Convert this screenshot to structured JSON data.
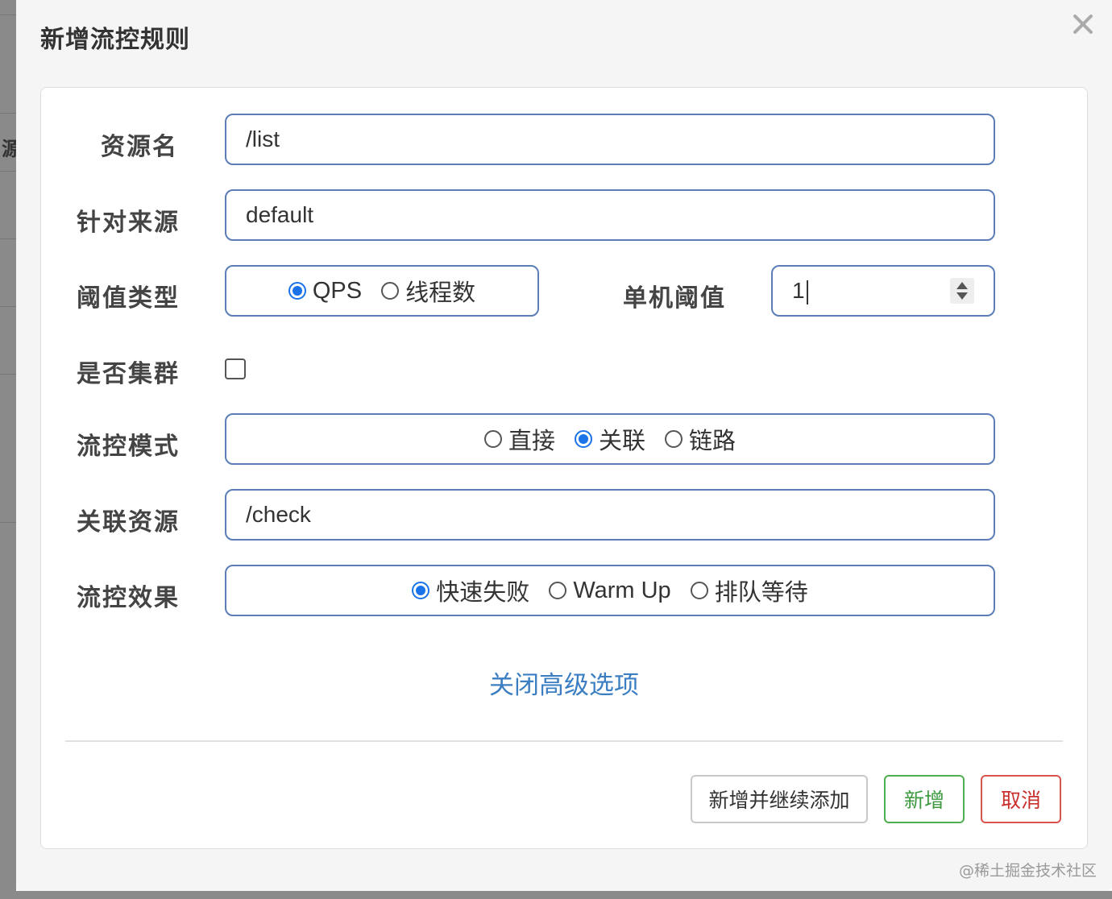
{
  "backdrop": {
    "partial_char": "源"
  },
  "modal": {
    "title": "新增流控规则"
  },
  "form": {
    "resource_name": {
      "label": "资源名",
      "value": "/list"
    },
    "limit_app": {
      "label": "针对来源",
      "value": "default"
    },
    "threshold_type": {
      "label": "阈值类型",
      "options": [
        "QPS",
        "线程数"
      ],
      "selected": "QPS"
    },
    "threshold": {
      "label": "单机阈值",
      "value": "1"
    },
    "cluster": {
      "label": "是否集群",
      "checked": false
    },
    "strategy": {
      "label": "流控模式",
      "options": [
        "直接",
        "关联",
        "链路"
      ],
      "selected": "关联"
    },
    "ref_resource": {
      "label": "关联资源",
      "value": "/check"
    },
    "control_behavior": {
      "label": "流控效果",
      "options": [
        "快速失败",
        "Warm Up",
        "排队等待"
      ],
      "selected": "快速失败"
    },
    "advanced_link": "关闭高级选项"
  },
  "footer": {
    "add_continue_label": "新增并继续添加",
    "add_label": "新增",
    "cancel_label": "取消"
  },
  "watermark": "@稀土掘金技术社区",
  "colors": {
    "accent": "#1a73e8",
    "input_border": "#5b7db8",
    "link": "#3b7ec1",
    "success": "#4caf50",
    "danger": "#d9534f"
  }
}
